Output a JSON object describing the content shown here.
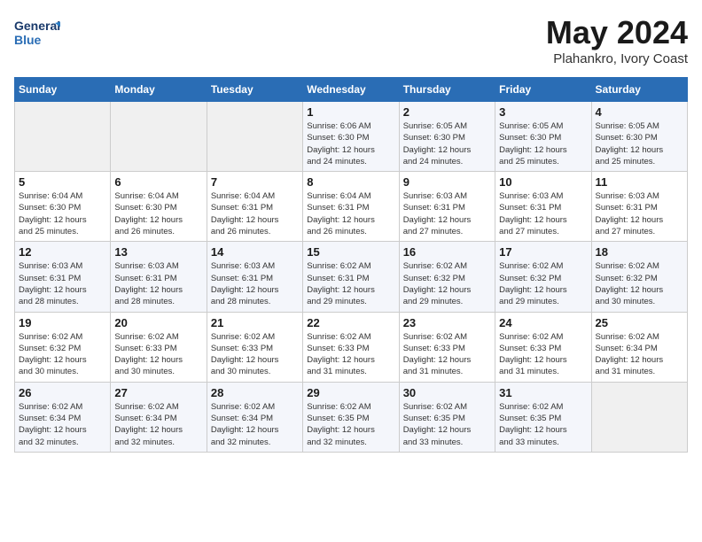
{
  "logo": {
    "line1": "General",
    "line2": "Blue"
  },
  "title": "May 2024",
  "subtitle": "Plahankro, Ivory Coast",
  "days_of_week": [
    "Sunday",
    "Monday",
    "Tuesday",
    "Wednesday",
    "Thursday",
    "Friday",
    "Saturday"
  ],
  "weeks": [
    [
      {
        "day": "",
        "info": ""
      },
      {
        "day": "",
        "info": ""
      },
      {
        "day": "",
        "info": ""
      },
      {
        "day": "1",
        "info": "Sunrise: 6:06 AM\nSunset: 6:30 PM\nDaylight: 12 hours\nand 24 minutes."
      },
      {
        "day": "2",
        "info": "Sunrise: 6:05 AM\nSunset: 6:30 PM\nDaylight: 12 hours\nand 24 minutes."
      },
      {
        "day": "3",
        "info": "Sunrise: 6:05 AM\nSunset: 6:30 PM\nDaylight: 12 hours\nand 25 minutes."
      },
      {
        "day": "4",
        "info": "Sunrise: 6:05 AM\nSunset: 6:30 PM\nDaylight: 12 hours\nand 25 minutes."
      }
    ],
    [
      {
        "day": "5",
        "info": "Sunrise: 6:04 AM\nSunset: 6:30 PM\nDaylight: 12 hours\nand 25 minutes."
      },
      {
        "day": "6",
        "info": "Sunrise: 6:04 AM\nSunset: 6:30 PM\nDaylight: 12 hours\nand 26 minutes."
      },
      {
        "day": "7",
        "info": "Sunrise: 6:04 AM\nSunset: 6:31 PM\nDaylight: 12 hours\nand 26 minutes."
      },
      {
        "day": "8",
        "info": "Sunrise: 6:04 AM\nSunset: 6:31 PM\nDaylight: 12 hours\nand 26 minutes."
      },
      {
        "day": "9",
        "info": "Sunrise: 6:03 AM\nSunset: 6:31 PM\nDaylight: 12 hours\nand 27 minutes."
      },
      {
        "day": "10",
        "info": "Sunrise: 6:03 AM\nSunset: 6:31 PM\nDaylight: 12 hours\nand 27 minutes."
      },
      {
        "day": "11",
        "info": "Sunrise: 6:03 AM\nSunset: 6:31 PM\nDaylight: 12 hours\nand 27 minutes."
      }
    ],
    [
      {
        "day": "12",
        "info": "Sunrise: 6:03 AM\nSunset: 6:31 PM\nDaylight: 12 hours\nand 28 minutes."
      },
      {
        "day": "13",
        "info": "Sunrise: 6:03 AM\nSunset: 6:31 PM\nDaylight: 12 hours\nand 28 minutes."
      },
      {
        "day": "14",
        "info": "Sunrise: 6:03 AM\nSunset: 6:31 PM\nDaylight: 12 hours\nand 28 minutes."
      },
      {
        "day": "15",
        "info": "Sunrise: 6:02 AM\nSunset: 6:31 PM\nDaylight: 12 hours\nand 29 minutes."
      },
      {
        "day": "16",
        "info": "Sunrise: 6:02 AM\nSunset: 6:32 PM\nDaylight: 12 hours\nand 29 minutes."
      },
      {
        "day": "17",
        "info": "Sunrise: 6:02 AM\nSunset: 6:32 PM\nDaylight: 12 hours\nand 29 minutes."
      },
      {
        "day": "18",
        "info": "Sunrise: 6:02 AM\nSunset: 6:32 PM\nDaylight: 12 hours\nand 30 minutes."
      }
    ],
    [
      {
        "day": "19",
        "info": "Sunrise: 6:02 AM\nSunset: 6:32 PM\nDaylight: 12 hours\nand 30 minutes."
      },
      {
        "day": "20",
        "info": "Sunrise: 6:02 AM\nSunset: 6:33 PM\nDaylight: 12 hours\nand 30 minutes."
      },
      {
        "day": "21",
        "info": "Sunrise: 6:02 AM\nSunset: 6:33 PM\nDaylight: 12 hours\nand 30 minutes."
      },
      {
        "day": "22",
        "info": "Sunrise: 6:02 AM\nSunset: 6:33 PM\nDaylight: 12 hours\nand 31 minutes."
      },
      {
        "day": "23",
        "info": "Sunrise: 6:02 AM\nSunset: 6:33 PM\nDaylight: 12 hours\nand 31 minutes."
      },
      {
        "day": "24",
        "info": "Sunrise: 6:02 AM\nSunset: 6:33 PM\nDaylight: 12 hours\nand 31 minutes."
      },
      {
        "day": "25",
        "info": "Sunrise: 6:02 AM\nSunset: 6:34 PM\nDaylight: 12 hours\nand 31 minutes."
      }
    ],
    [
      {
        "day": "26",
        "info": "Sunrise: 6:02 AM\nSunset: 6:34 PM\nDaylight: 12 hours\nand 32 minutes."
      },
      {
        "day": "27",
        "info": "Sunrise: 6:02 AM\nSunset: 6:34 PM\nDaylight: 12 hours\nand 32 minutes."
      },
      {
        "day": "28",
        "info": "Sunrise: 6:02 AM\nSunset: 6:34 PM\nDaylight: 12 hours\nand 32 minutes."
      },
      {
        "day": "29",
        "info": "Sunrise: 6:02 AM\nSunset: 6:35 PM\nDaylight: 12 hours\nand 32 minutes."
      },
      {
        "day": "30",
        "info": "Sunrise: 6:02 AM\nSunset: 6:35 PM\nDaylight: 12 hours\nand 33 minutes."
      },
      {
        "day": "31",
        "info": "Sunrise: 6:02 AM\nSunset: 6:35 PM\nDaylight: 12 hours\nand 33 minutes."
      },
      {
        "day": "",
        "info": ""
      }
    ]
  ]
}
